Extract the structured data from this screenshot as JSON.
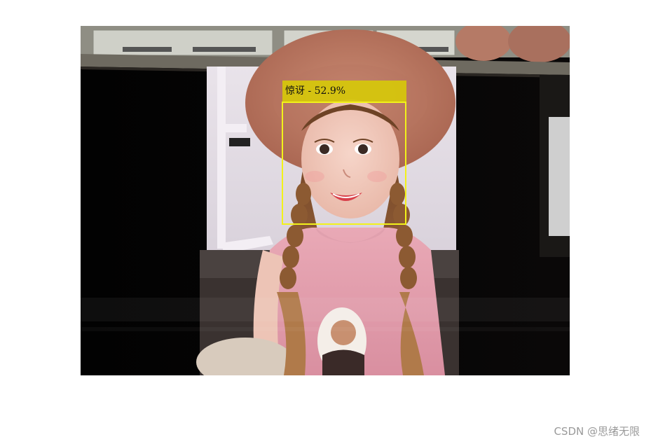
{
  "detection": {
    "label": "惊讶 - 52.9%",
    "box_color": "#f2f21a",
    "label_bg": "#d6c80a"
  },
  "watermark": {
    "text": "CSDN @思绪无限"
  }
}
